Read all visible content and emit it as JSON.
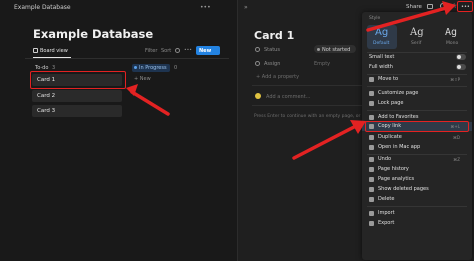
{
  "left": {
    "top_title": "Example Database",
    "db_title": "Example Database",
    "view_tab": "Board view",
    "filter": "Filter",
    "sort": "Sort",
    "new_button": "New",
    "columns": [
      {
        "label": "To-do",
        "count": "3"
      },
      {
        "label": "In Progress",
        "count": "0"
      }
    ],
    "cards": [
      "Card 1",
      "Card 2",
      "Card 3"
    ],
    "add_new": "+ New"
  },
  "right": {
    "share": "Share",
    "card_title": "Card 1",
    "props": [
      {
        "label": "Status",
        "value": "Not started"
      },
      {
        "label": "Assign",
        "value": "Empty"
      }
    ],
    "add_property": "+ Add a property",
    "add_comment": "Add a comment...",
    "hint": "Press Enter to continue with an empty page, or create a template"
  },
  "menu": {
    "style_label": "Style",
    "fonts": [
      {
        "glyph": "Ag",
        "name": "Default"
      },
      {
        "glyph": "Ag",
        "name": "Serif"
      },
      {
        "glyph": "Ag",
        "name": "Mono"
      }
    ],
    "items": {
      "small_text": "Small text",
      "full_width": "Full width",
      "move_to": "Move to",
      "move_to_sc": "⌘⇧P",
      "customize_page": "Customize page",
      "lock_page": "Lock page",
      "add_favorites": "Add to Favorites",
      "copy_link": "Copy link",
      "copy_link_sc": "⌘+L",
      "duplicate": "Duplicate",
      "duplicate_sc": "⌘D",
      "open_mac": "Open in Mac app",
      "undo": "Undo",
      "undo_sc": "⌘Z",
      "page_history": "Page history",
      "page_analytics": "Page analytics",
      "show_deleted": "Show deleted pages",
      "delete": "Delete",
      "import": "Import",
      "export": "Export"
    }
  },
  "colors": {
    "accent_blue": "#2383e2",
    "annotation_red": "#e32222"
  }
}
